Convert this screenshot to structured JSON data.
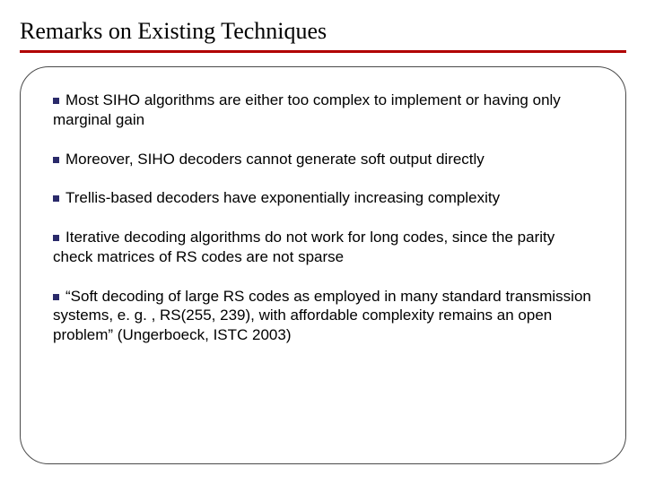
{
  "title": "Remarks on Existing Techniques",
  "bullets": [
    {
      "text": "Most SIHO algorithms are either too complex to implement or having only marginal gain"
    },
    {
      "text": "Moreover, SIHO decoders cannot generate soft output directly"
    },
    {
      "text": "Trellis-based decoders have exponentially increasing complexity"
    },
    {
      "text": "Iterative decoding algorithms do not work for long codes, since the parity check matrices of RS codes are not sparse"
    },
    {
      "text": "“Soft decoding of large RS codes as employed in many standard transmission systems, e. g. , RS(255, 239), with affordable complexity remains an open problem” (Ungerboeck, ISTC 2003)"
    }
  ]
}
